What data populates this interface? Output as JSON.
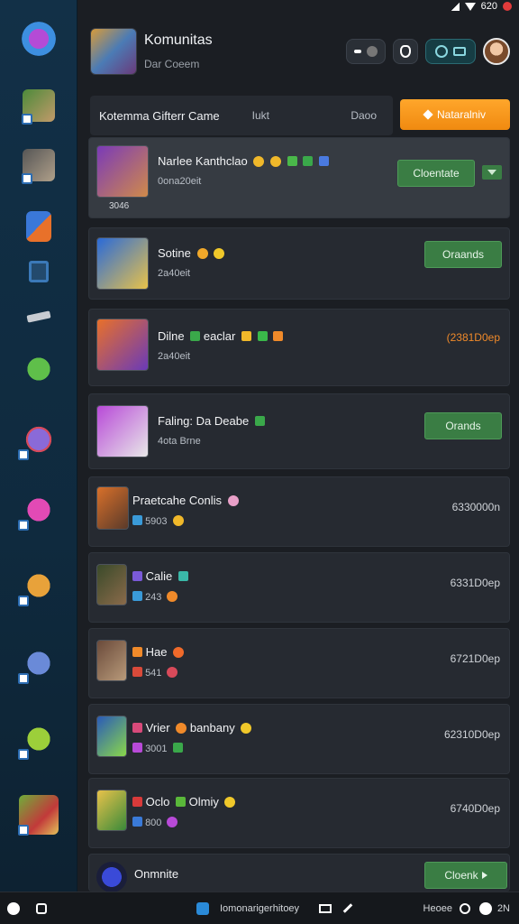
{
  "statusbar": {
    "time": "620"
  },
  "header": {
    "title": "Komunitas",
    "subtitle": "Dar Coeem"
  },
  "filter": {
    "main": "Kotemma Gifterr Came",
    "mid": "Iukt",
    "right": "Daoo",
    "notify_label": "Nataralniv"
  },
  "rows": [
    {
      "name": "Narlee Kanthclao",
      "meta": "0ona20eit",
      "under": "3046",
      "button": "Cloentate",
      "selected": true
    },
    {
      "name": "Sotine",
      "meta": "2a40eit",
      "button": "Oraands"
    },
    {
      "name": "Dilne",
      "name2": "eaclar",
      "meta": "2a40eit",
      "price": "(2381D0ep"
    },
    {
      "name": "Faling: Da Deabe",
      "meta": "4ota Brne",
      "button": "Orands"
    },
    {
      "name": "Praetcahe Conlis",
      "meta": "5903",
      "price": "6330000n"
    },
    {
      "name": "Calie",
      "meta": "243",
      "price": "6331D0ep"
    },
    {
      "name": "Hae",
      "meta": "541",
      "price": "6721D0ep"
    },
    {
      "name": "Vrier",
      "name2": "banbany",
      "meta": "3001",
      "price": "62310D0ep"
    },
    {
      "name": "Oclo",
      "name2": "Olmiy",
      "meta": "800",
      "price": "6740D0ep"
    },
    {
      "name": "Onmnite",
      "button": "Cloenk"
    }
  ],
  "bottom": {
    "center": "Iomonarigerhitoey",
    "right": "Heoee",
    "right2": "2N"
  }
}
